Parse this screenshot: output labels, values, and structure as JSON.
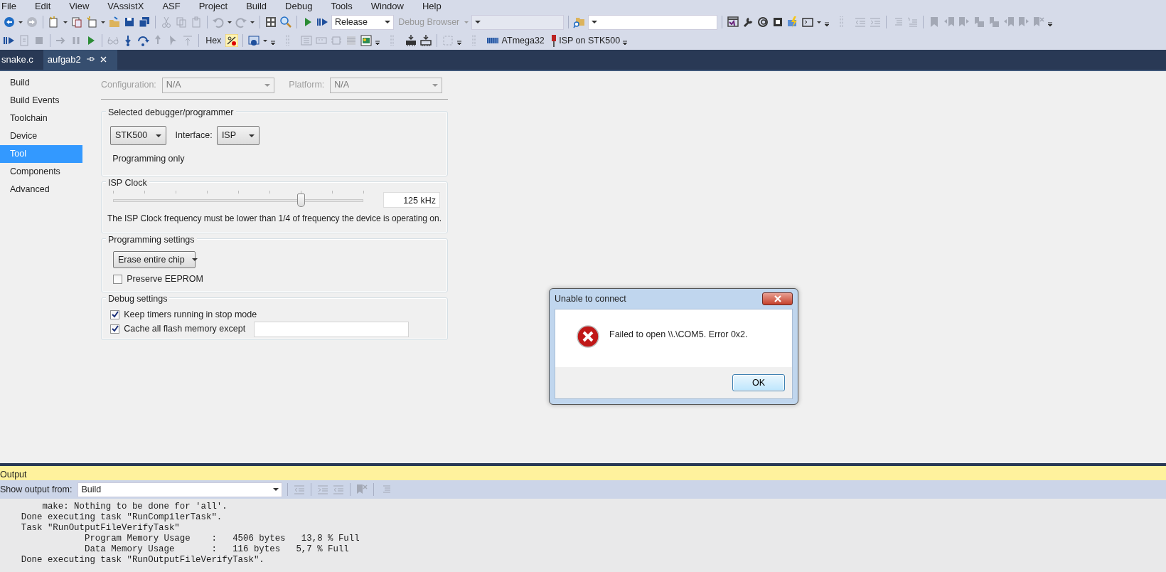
{
  "menu": [
    {
      "label": "File"
    },
    {
      "label": "Edit"
    },
    {
      "label": "View"
    },
    {
      "label": "VAssistX"
    },
    {
      "label": "ASF"
    },
    {
      "label": "Project"
    },
    {
      "label": "Build"
    },
    {
      "label": "Debug"
    },
    {
      "label": "Tools"
    },
    {
      "label": "Window"
    },
    {
      "label": "Help"
    }
  ],
  "toolbar": {
    "configuration": "Release",
    "debug_browser": "Debug Browser",
    "hex_label": "Hex",
    "device": "ATmega32",
    "tool": "ISP on STK500"
  },
  "tabs": [
    {
      "label": "snake.c",
      "selected": false
    },
    {
      "label": "aufgab2",
      "selected": true
    }
  ],
  "sidebar": {
    "items": [
      {
        "label": "Build",
        "selected": false
      },
      {
        "label": "Build Events",
        "selected": false
      },
      {
        "label": "Toolchain",
        "selected": false
      },
      {
        "label": "Device",
        "selected": false
      },
      {
        "label": "Tool",
        "selected": true
      },
      {
        "label": "Components",
        "selected": false
      },
      {
        "label": "Advanced",
        "selected": false
      }
    ]
  },
  "config_bar": {
    "configuration_label": "Configuration:",
    "configuration_value": "N/A",
    "platform_label": "Platform:",
    "platform_value": "N/A"
  },
  "debugger_group": {
    "title": "Selected debugger/programmer",
    "tool": "STK500",
    "interface_label": "Interface:",
    "interface": "ISP",
    "mode": "Programming only"
  },
  "isp_clock_group": {
    "title": "ISP Clock",
    "level": 0.75,
    "value": "125 kHz",
    "note": "The ISP Clock frequency must be lower than 1/4 of frequency the device is operating on."
  },
  "programming_group": {
    "title": "Programming settings",
    "erase_mode": "Erase entire chip",
    "preserve_eeprom": {
      "label": "Preserve EEPROM",
      "checked": false
    }
  },
  "debug_group": {
    "title": "Debug settings",
    "options": [
      {
        "label": "Keep timers running in stop mode",
        "checked": true,
        "kind": "plain"
      },
      {
        "label": "Cache all flash memory except",
        "checked": true,
        "kind": "with-field"
      }
    ]
  },
  "output": {
    "title": "Output",
    "source_label": "Show output from:",
    "source": "Build",
    "lines": [
      "        make: Nothing to be done for 'all'.",
      "    Done executing task \"RunCompilerTask\".",
      "    Task \"RunOutputFileVerifyTask\"",
      "                Program Memory Usage    :   4506 bytes   13,8 % Full",
      "                Data Memory Usage       :   116 bytes   5,7 % Full",
      "    Done executing task \"RunOutputFileVerifyTask\"."
    ]
  },
  "dialog": {
    "title": "Unable to connect",
    "message": "Failed to open \\\\.\\COM5. Error 0x2.",
    "button": "OK"
  }
}
